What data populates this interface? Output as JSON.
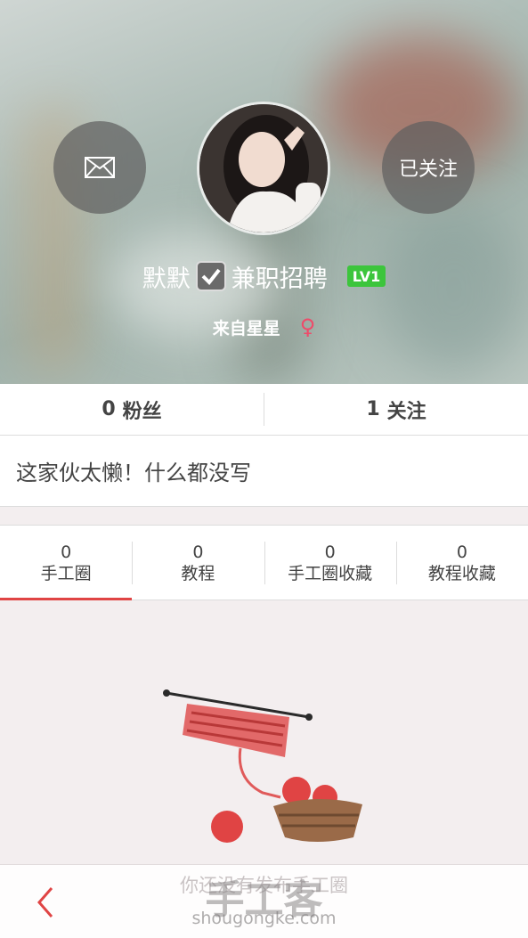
{
  "header": {
    "follow_button_label": "已关注",
    "username_part1": "默默",
    "username_part2": "兼职招聘",
    "level_badge": "LV1",
    "location": "来自星星",
    "gender_symbol": "♀"
  },
  "stats": {
    "fans_count": "0",
    "fans_label": "粉丝",
    "following_count": "1",
    "following_label": "关注"
  },
  "bio": "这家伙太懒！什么都没写",
  "tabs": [
    {
      "count": "0",
      "label": "手工圈",
      "active": true
    },
    {
      "count": "0",
      "label": "教程",
      "active": false
    },
    {
      "count": "0",
      "label": "手工圈收藏",
      "active": false
    },
    {
      "count": "0",
      "label": "教程收藏",
      "active": false
    }
  ],
  "empty_state": {
    "text": "你还没有发布手工圈"
  },
  "watermark": {
    "title": "手工客",
    "url": "shougongke.com"
  },
  "colors": {
    "accent": "#e04444",
    "level_badge": "#3cc53c",
    "female": "#ee4b6a"
  },
  "icons": {
    "message": "envelope-icon",
    "back": "chevron-left-icon",
    "verified": "checkbox-checked-icon"
  }
}
